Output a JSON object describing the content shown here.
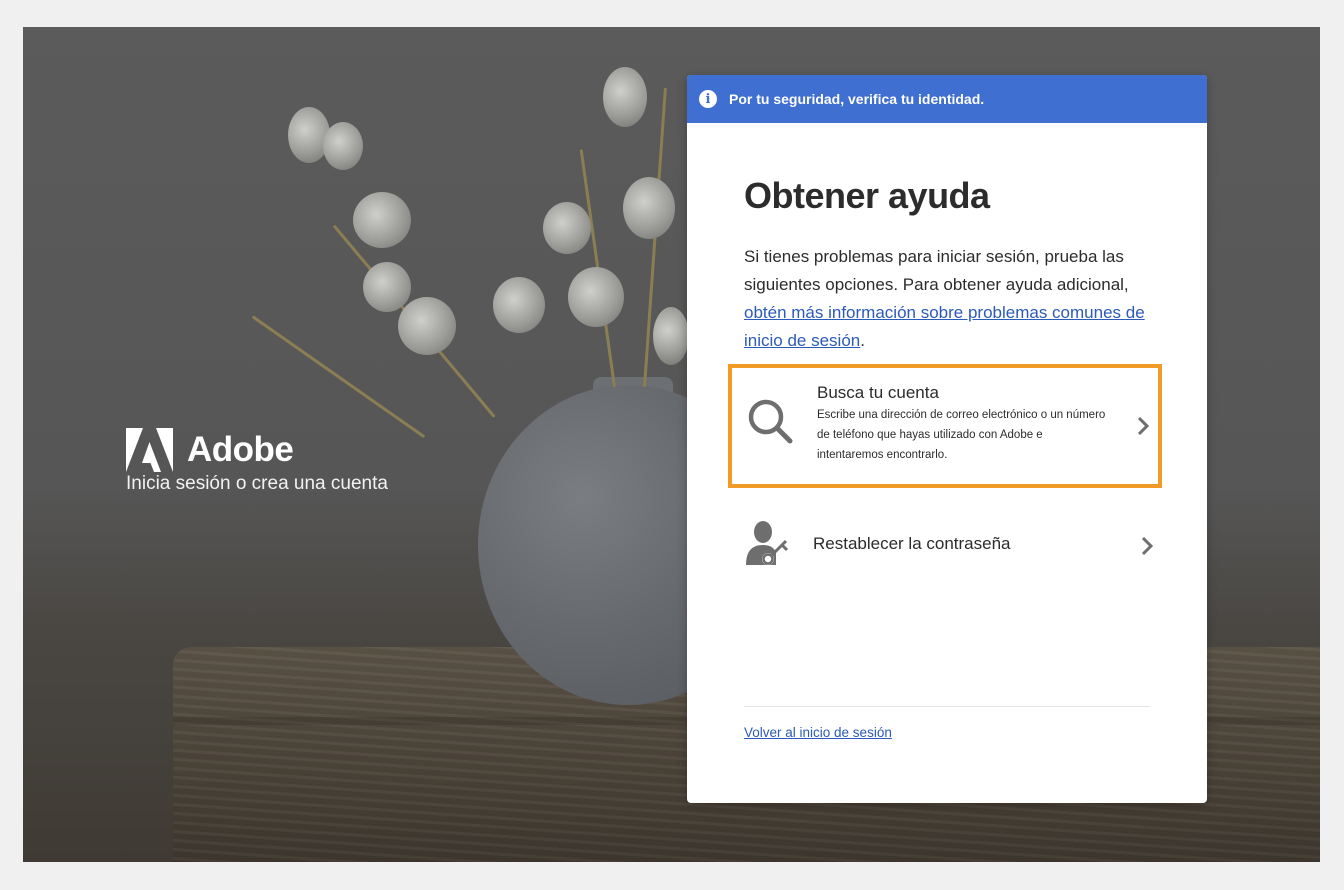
{
  "banner": {
    "text": "Por tu seguridad, verifica tu identidad.",
    "color": "#3f6fd1",
    "icon": "info-icon"
  },
  "brand": {
    "name": "Adobe",
    "tagline": "Inicia sesión o crea una cuenta",
    "logo": "adobe-logo"
  },
  "help": {
    "title": "Obtener ayuda",
    "description_before": "Si tienes problemas para iniciar sesión, prueba las siguientes opciones. Para obtener ayuda adicional, ",
    "description_link": "obtén más información sobre problemas comunes de inicio de sesión",
    "description_after": "."
  },
  "options": {
    "find_account": {
      "title": "Busca tu cuenta",
      "description": "Escribe una dirección de correo electrónico o un número de teléfono que hayas utilizado con Adobe e intentaremos encontrarlo.",
      "icon": "search-icon",
      "highlight_color": "#f29a26"
    },
    "reset_password": {
      "title": "Restablecer la contraseña",
      "icon": "user-key-icon"
    }
  },
  "footer": {
    "back_link": "Volver al inicio de sesión"
  }
}
